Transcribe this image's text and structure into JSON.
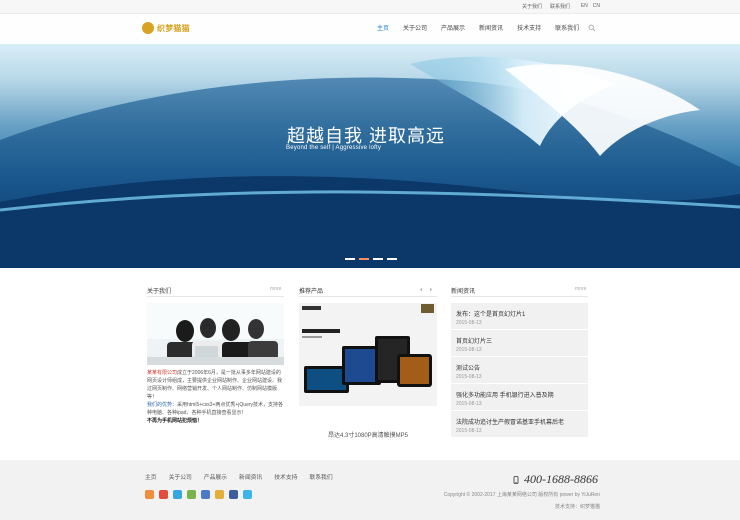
{
  "topbar": {
    "links": [
      "关于我们",
      "联系我们"
    ],
    "lang": [
      "EN",
      "CN"
    ]
  },
  "header": {
    "logo_text": "织梦猫猫",
    "nav": [
      "主页",
      "关于公司",
      "产品展示",
      "新闻资讯",
      "技术支持",
      "联系我们"
    ],
    "active_index": 0
  },
  "banner": {
    "title": "超越自我 进取高远",
    "subtitle": "Beyond the self | Aggressive lofty",
    "slide_count": 4,
    "active_slide": 1
  },
  "about": {
    "title": "关于我们",
    "more": "more",
    "company": "某某有限公司",
    "paragraph": "成立于2006年6月，是一批从事多年网站建设的网页设计师组成，主要提供企业网站制作、企业网站建设、我过网页制作、网络营销开发、个人网站制作、仿制网站模版等！",
    "advantage_label": "我们的优势：",
    "advantage_text": "采用html5+css3+两点优秀+jQuery技术，支持各种电脑、各种ipad、各种手机直接查看显示！",
    "slogan": "不再为手机网站犯烦恼！"
  },
  "products": {
    "title": "推荐产品",
    "caption": "昂达4.3寸1080P高清触摸MP5"
  },
  "news": {
    "title": "新闻资讯",
    "more": "more",
    "items": [
      {
        "title": "发布：这个是首页幻灯片1",
        "date": "2015-08-13"
      },
      {
        "title": "首页幻灯片三",
        "date": "2015-08-13"
      },
      {
        "title": "测试公告",
        "date": "2015-08-13"
      },
      {
        "title": "强化多功能应用 手机银行进入普及期",
        "date": "2015-08-13"
      },
      {
        "title": "法院成功追讨生产假冒诺基亚手机幕后老",
        "date": "2015-08-13"
      }
    ]
  },
  "footer": {
    "nav": [
      "主页",
      "关于公司",
      "产品展示",
      "新闻资讯",
      "技术支持",
      "联系我们"
    ],
    "phone": "400-1688-8866",
    "copyright": "Copyright © 2002-2017 上海某某网络公司 版权所有 power by YiJuRen",
    "support": "技术支持：织梦猫猫"
  },
  "colors": {
    "accent": "#1e7bd0",
    "logo": "#d8a321",
    "highlight": "#d63e2e",
    "slide_active": "#ff8c5a"
  },
  "icons": [
    "search-icon",
    "phone-icon",
    "share-icon",
    "weibo-icon",
    "qq-icon",
    "wechat-icon",
    "renren-icon",
    "douban-icon",
    "facebook-icon",
    "twitter-icon"
  ]
}
